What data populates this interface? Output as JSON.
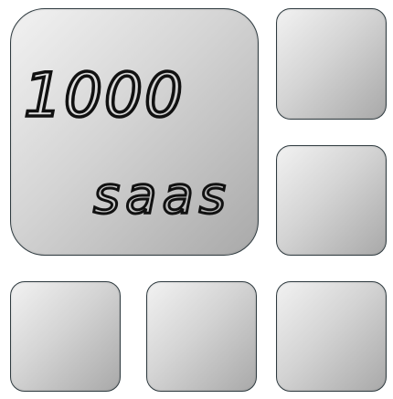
{
  "logo": {
    "line1": "1000",
    "line2": "saas"
  },
  "colors": {
    "tile_border": "#2f3b40",
    "tile_light": "#f2f2f2",
    "tile_dark": "#a9a9a9",
    "text": "#111111"
  }
}
